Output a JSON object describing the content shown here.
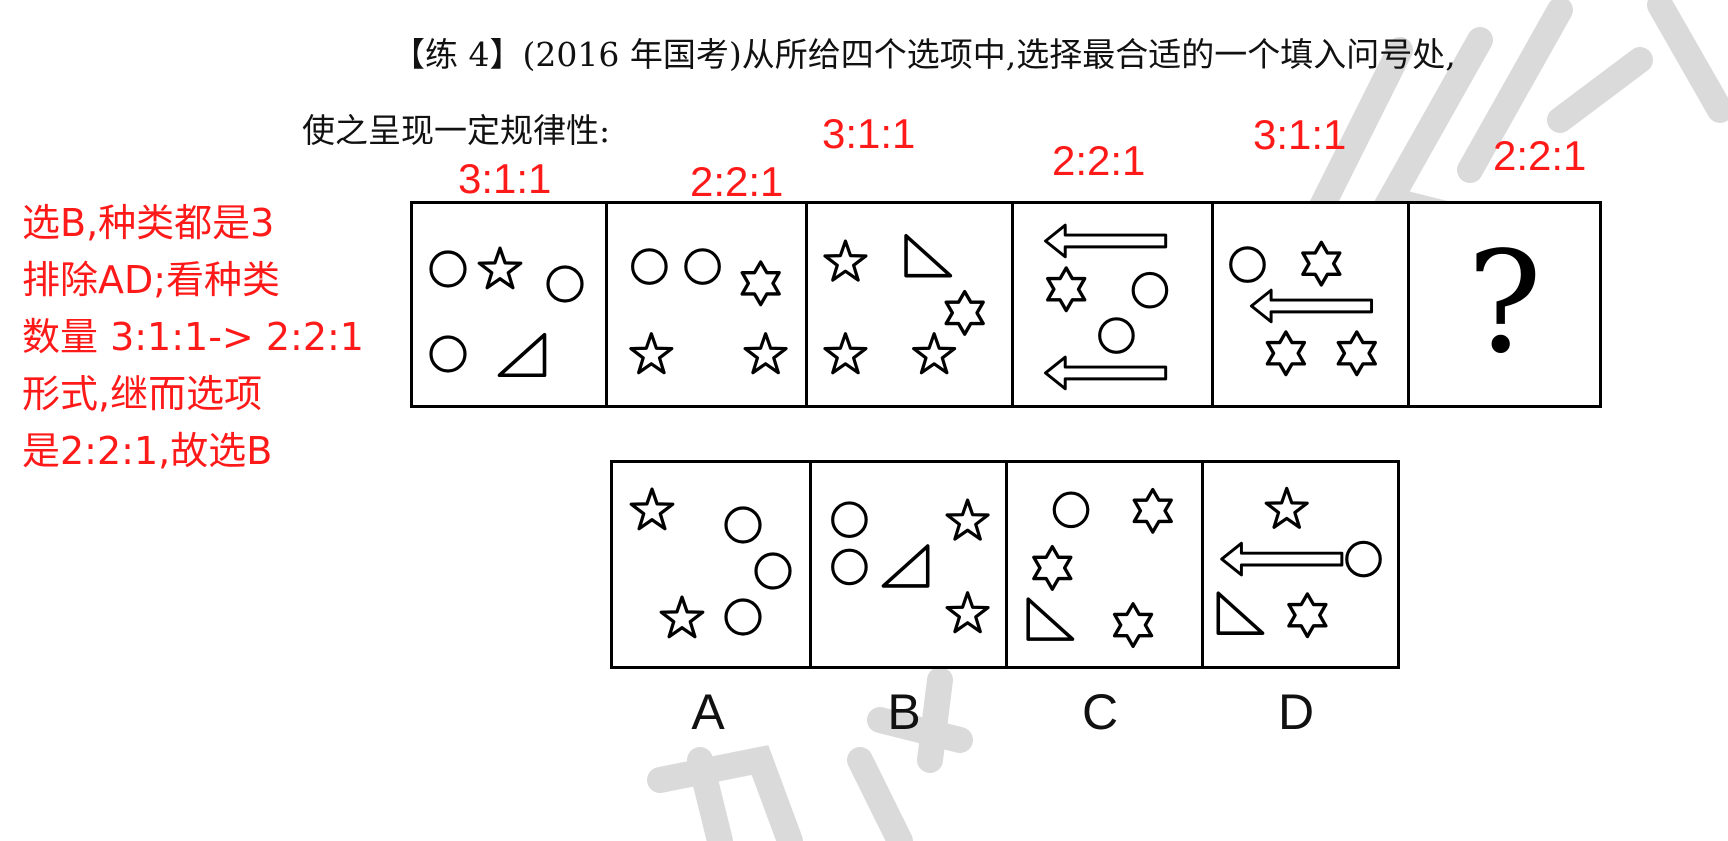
{
  "question": {
    "line1": "【练 4】(2016 年国考)从所给四个选项中,选择最合适的一个填入问号处,",
    "line2": "使之呈现一定规律性:"
  },
  "ratios": [
    "3:1:1",
    "2:2:1",
    "3:1:1",
    "2:2:1",
    "3:1:1",
    "2:2:1"
  ],
  "note": {
    "lines": [
      "选B,种类都是3",
      "排除AD;看种类",
      "数量 3:1:1-> 2:2:1",
      "形式,继而选项",
      "是2:2:1,故选B"
    ]
  },
  "question_mark": "?",
  "options": [
    "A",
    "B",
    "C",
    "D"
  ],
  "colors": {
    "annotation": "#ff1a1a",
    "ink": "#000000",
    "watermark": "#d8d8d8"
  },
  "icons": [
    "circle-icon",
    "star-icon",
    "hexagram-icon",
    "triangle-icon",
    "arrow-left-icon"
  ]
}
